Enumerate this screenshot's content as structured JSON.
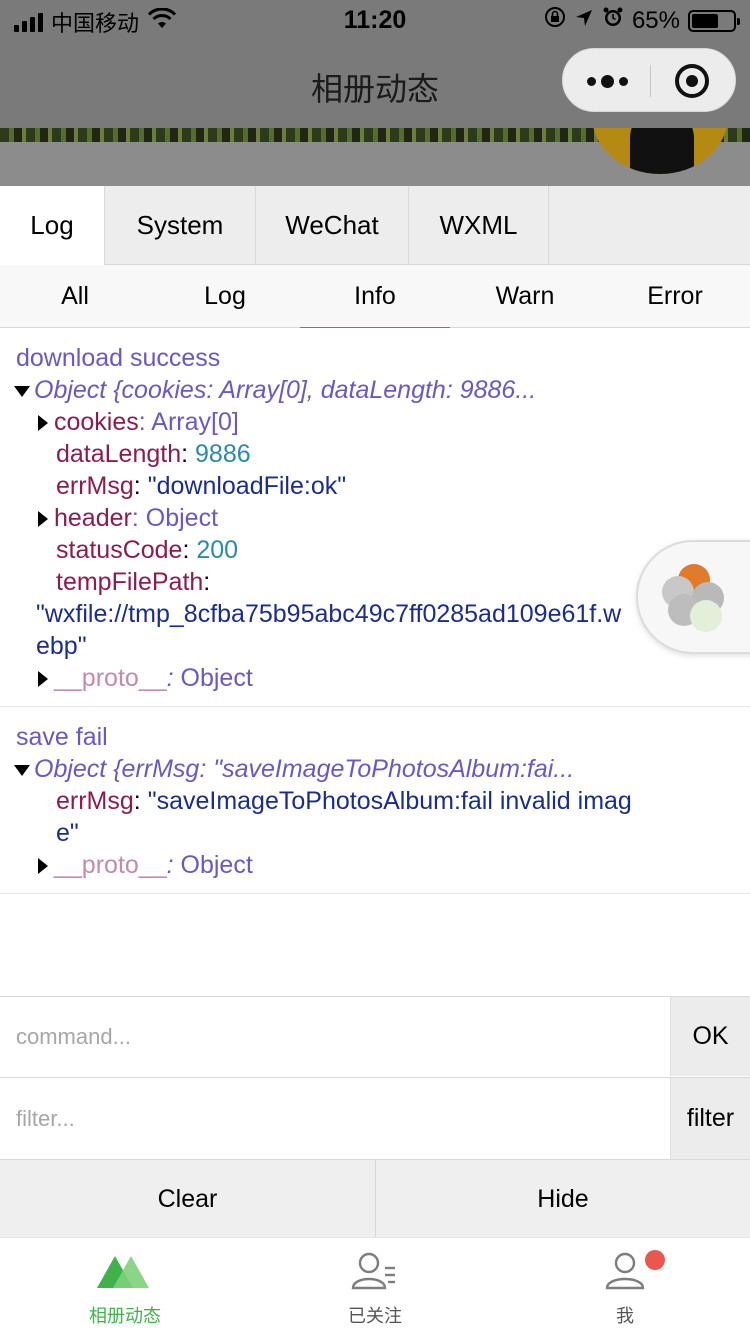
{
  "status_bar": {
    "carrier": "中国移动",
    "time": "11:20",
    "battery": "65%",
    "battery_level": 0.65,
    "icons": [
      "signal-icon",
      "wifi-icon",
      "lock-rotation-icon",
      "location-arrow-icon",
      "alarm-icon",
      "battery-icon"
    ]
  },
  "navbar": {
    "title": "相册动态",
    "more_icon": "more-dots-icon",
    "close_icon": "target-circle-icon"
  },
  "vconsole": {
    "main_tabs": [
      {
        "label": "Log",
        "active": true
      },
      {
        "label": "System",
        "active": false
      },
      {
        "label": "WeChat",
        "active": false
      },
      {
        "label": "WXML",
        "active": false
      }
    ],
    "sub_tabs": [
      {
        "label": "All",
        "active": false
      },
      {
        "label": "Log",
        "active": false
      },
      {
        "label": "Info",
        "active": true
      },
      {
        "label": "Warn",
        "active": false
      },
      {
        "label": "Error",
        "active": false
      }
    ],
    "entries": [
      {
        "message": "download success",
        "summary": "Object {cookies: Array[0], dataLength: 9886...",
        "cookies_key": "cookies",
        "cookies_val": "Array[0]",
        "dataLength_key": "dataLength",
        "dataLength_val": "9886",
        "errMsg_key": "errMsg",
        "errMsg_val": "\"downloadFile:ok\"",
        "header_key": "header",
        "header_val": "Object",
        "statusCode_key": "statusCode",
        "statusCode_val": "200",
        "tempFilePath_key": "tempFilePath",
        "tempFilePath_val": "\"wxfile://tmp_8cfba75b95abc49c7ff0285ad109e61f.webp\"",
        "proto_key": "__proto__",
        "proto_val": "Object"
      },
      {
        "message": "save fail",
        "summary": "Object {errMsg: \"saveImageToPhotosAlbum:fai...",
        "errMsg_key": "errMsg",
        "errMsg_val": "\"saveImageToPhotosAlbum:fail invalid image\"",
        "proto_key": "__proto__",
        "proto_val": "Object"
      }
    ],
    "command": {
      "placeholder": "command...",
      "button": "OK"
    },
    "filter": {
      "placeholder": "filter...",
      "button": "filter"
    },
    "bottom_buttons": {
      "clear": "Clear",
      "hide": "Hide"
    }
  },
  "tabbar": {
    "items": [
      {
        "label": "相册动态",
        "icon": "mountain-icon",
        "active": true
      },
      {
        "label": "已关注",
        "icon": "user-list-icon",
        "active": false
      },
      {
        "label": "我",
        "icon": "user-icon",
        "active": false,
        "badge": true
      }
    ]
  },
  "colors": {
    "accent_green": "#3fb24a",
    "active_tab_underline": "#3b83e6",
    "log_message": "#6a58c5",
    "key": "#8b1c4f",
    "number": "#2a8aa8",
    "string": "#1a2d8f",
    "badge_red": "#e9574d"
  }
}
